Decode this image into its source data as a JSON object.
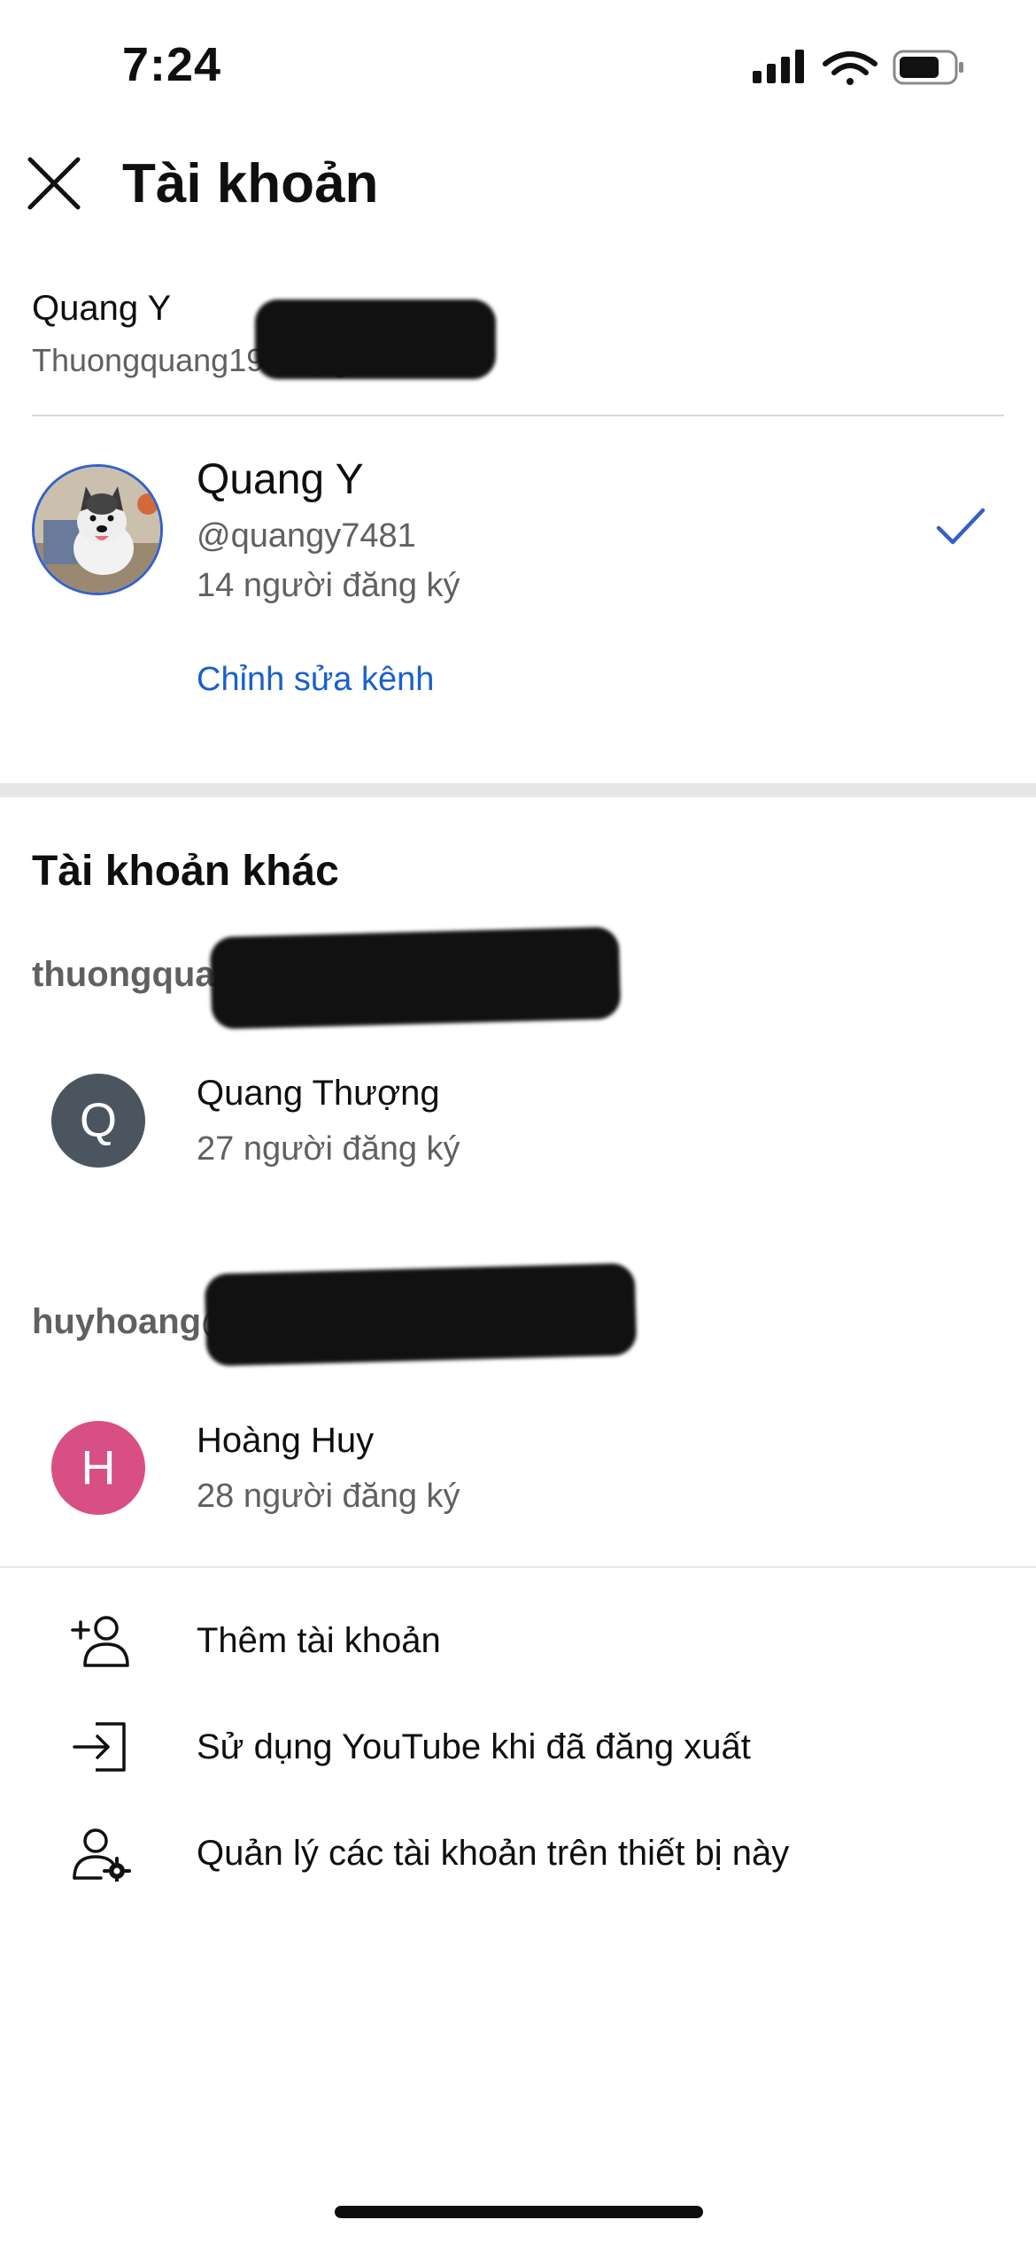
{
  "status_bar": {
    "time": "7:24",
    "icons": [
      "signal-icon",
      "wifi-icon",
      "battery-icon"
    ]
  },
  "header": {
    "close_icon": "close-icon",
    "title": "Tài khoản"
  },
  "google_account": {
    "name": "Quang Y",
    "email": "Thuongquang1986@gmail.com"
  },
  "current_channel": {
    "name": "Quang Y",
    "handle": "@quangy7481",
    "subscribers": "14 người đăng ký",
    "edit_label": "Chỉnh sửa kênh",
    "check_icon": "checkmark-icon",
    "accent_color": "#3461c9"
  },
  "other_accounts": {
    "title": "Tài khoản khác",
    "groups": [
      {
        "email": "thuongquang@gmail.com",
        "channel": {
          "initial": "Q",
          "name": "Quang Thượng",
          "subscribers": "27 người đăng ký",
          "avatar_color": "#4a5560"
        }
      },
      {
        "email": "huyhoang@gmail.com",
        "channel": {
          "initial": "H",
          "name": "Hoàng Huy",
          "subscribers": "28 người đăng ký",
          "avatar_color": "#d84f84"
        }
      }
    ]
  },
  "menu": [
    {
      "icon": "add-account-icon",
      "label": "Thêm tài khoản"
    },
    {
      "icon": "sign-in-icon",
      "label": "Sử dụng YouTube khi đã đăng xuất"
    },
    {
      "icon": "manage-accounts-icon",
      "label": "Quản lý các tài khoản trên thiết bị này"
    }
  ]
}
